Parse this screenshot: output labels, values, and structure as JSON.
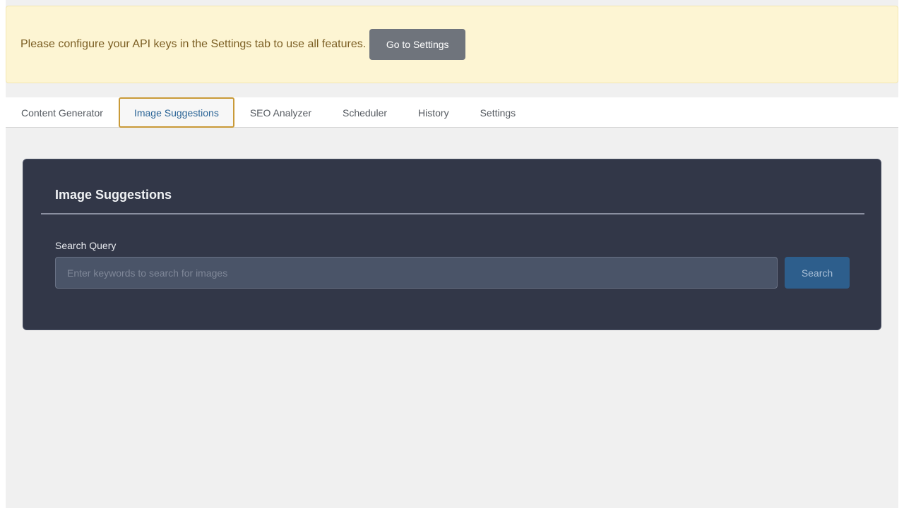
{
  "notice": {
    "message": "Please configure your API keys in the Settings tab to use all features.",
    "button_label": "Go to Settings"
  },
  "tabs": [
    {
      "label": "Content Generator",
      "active": false
    },
    {
      "label": "Image Suggestions",
      "active": true
    },
    {
      "label": "SEO Analyzer",
      "active": false
    },
    {
      "label": "Scheduler",
      "active": false
    },
    {
      "label": "History",
      "active": false
    },
    {
      "label": "Settings",
      "active": false
    }
  ],
  "panel": {
    "title": "Image Suggestions",
    "search": {
      "label": "Search Query",
      "value": "",
      "placeholder": "Enter keywords to search for images",
      "button_label": "Search"
    }
  },
  "colors": {
    "notice_bg": "#fdf5d3",
    "notice_text": "#7b5e23",
    "active_tab_border": "#c99a38",
    "active_tab_text": "#2a6496",
    "panel_bg": "#323748",
    "search_button": "#2d5e8c"
  }
}
